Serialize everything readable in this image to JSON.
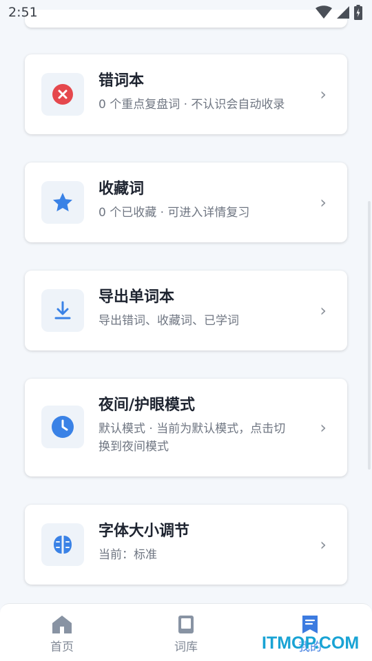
{
  "status_bar": {
    "time": "2:51"
  },
  "cards": [
    {
      "title": "错词本",
      "subtitle": "0 个重点复盘词 · 不认识会自动收录",
      "icon": "error-x-icon"
    },
    {
      "title": "收藏词",
      "subtitle": "0 个已收藏 · 可进入详情复习",
      "icon": "star-icon"
    },
    {
      "title": "导出单词本",
      "subtitle": "导出错词、收藏词、已学词",
      "icon": "download-icon"
    },
    {
      "title": "夜间/护眼模式",
      "subtitle_line1": "默认模式 · 当前为默认模式，点击切",
      "subtitle_line2": "换到夜间模式",
      "icon": "clock-icon"
    },
    {
      "title": "字体大小调节",
      "subtitle": "当前：标准",
      "icon": "brain-icon"
    }
  ],
  "tabs": [
    {
      "label": "首页",
      "icon": "home-icon"
    },
    {
      "label": "词库",
      "icon": "book-icon"
    },
    {
      "label": "我的",
      "icon": "bookmark-icon",
      "active": true
    }
  ],
  "watermark": "ITMOP.COM",
  "colors": {
    "accent": "#3c7be0",
    "error": "#e5484d",
    "icon_blue": "#3a82e6"
  }
}
